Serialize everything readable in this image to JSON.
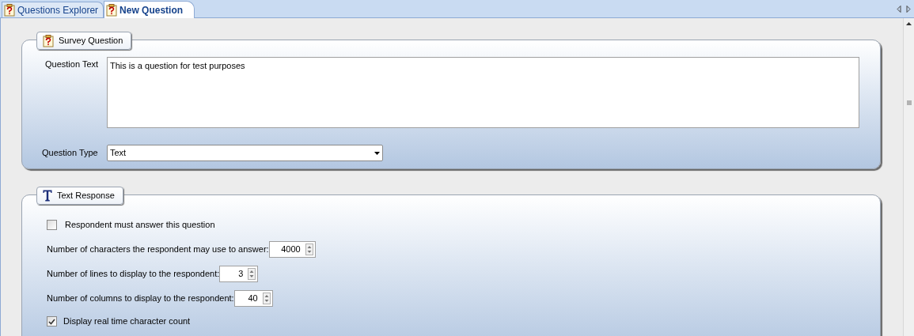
{
  "tabs": [
    {
      "label": "Questions Explorer",
      "selected": false
    },
    {
      "label": "New Question",
      "selected": true
    }
  ],
  "survey_question": {
    "title": "Survey Question",
    "question_text": {
      "label": "Question Text",
      "value": "This is a question for test purposes"
    },
    "question_type": {
      "label": "Question Type",
      "value": "Text"
    }
  },
  "text_response": {
    "title": "Text Response",
    "items": [
      {
        "kind": "checkbox",
        "label": "Respondent must answer this question",
        "checked": false
      },
      {
        "kind": "spinner",
        "label": "Number of characters the respondent may use to answer:",
        "value": "4000"
      },
      {
        "kind": "spinner",
        "label": "Number of lines to display to the respondent:",
        "value": "3"
      },
      {
        "kind": "spinner",
        "label": "Number of columns to display to the respondent:",
        "value": "40"
      },
      {
        "kind": "checkbox",
        "label": "Display real time character count",
        "checked": true
      }
    ]
  }
}
